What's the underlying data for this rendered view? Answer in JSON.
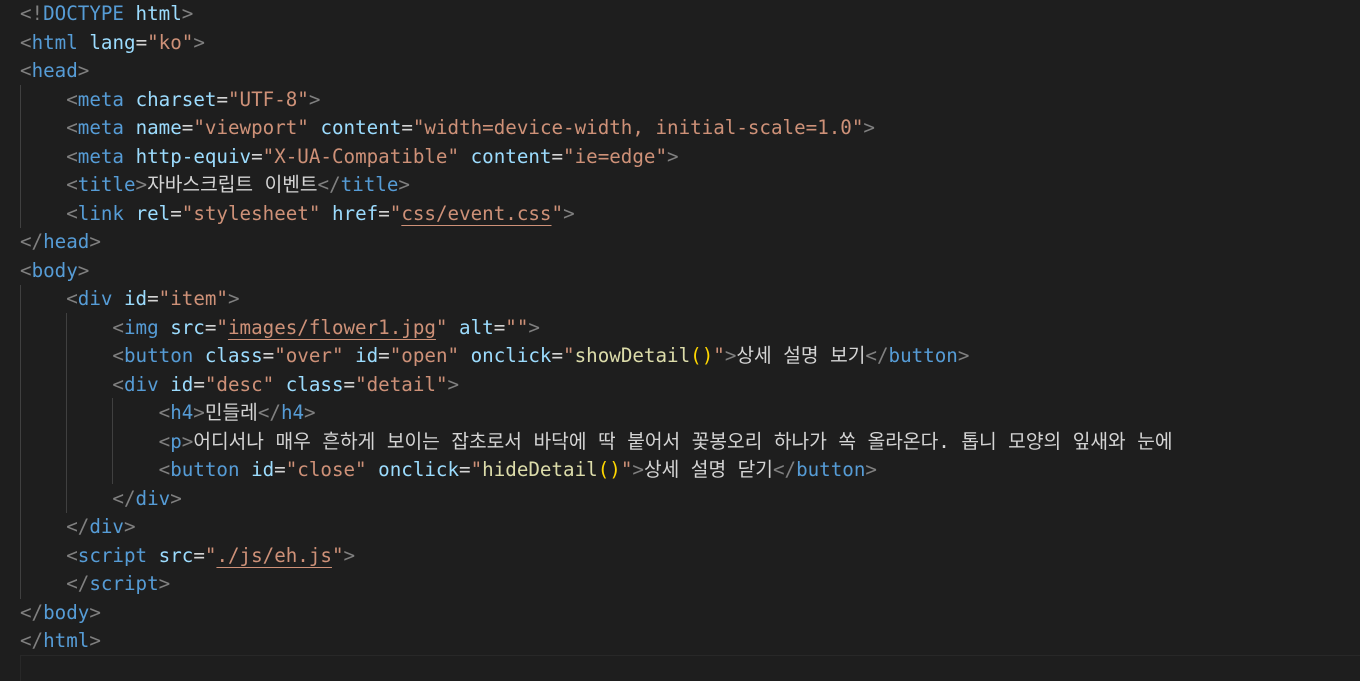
{
  "editor": {
    "background": "#1e1e1e",
    "colors": {
      "punctuation": "#808080",
      "tag": "#569cd6",
      "attribute": "#9cdcfe",
      "string": "#ce9178",
      "function": "#dcdcaa",
      "parenthesis": "#ffd700",
      "text": "#d4d4d4"
    },
    "lines": [
      [
        [
          "punc",
          "<!"
        ],
        [
          "tag",
          "DOCTYPE"
        ],
        [
          "text",
          " "
        ],
        [
          "attr",
          "html"
        ],
        [
          "punc",
          ">"
        ]
      ],
      [
        [
          "punc",
          "<"
        ],
        [
          "tag",
          "html"
        ],
        [
          "text",
          " "
        ],
        [
          "attr",
          "lang"
        ],
        [
          "text",
          "="
        ],
        [
          "str",
          "\"ko\""
        ],
        [
          "punc",
          ">"
        ]
      ],
      [
        [
          "punc",
          "<"
        ],
        [
          "tag",
          "head"
        ],
        [
          "punc",
          ">"
        ]
      ],
      [
        [
          "text",
          "    "
        ],
        [
          "punc",
          "<"
        ],
        [
          "tag",
          "meta"
        ],
        [
          "text",
          " "
        ],
        [
          "attr",
          "charset"
        ],
        [
          "text",
          "="
        ],
        [
          "str",
          "\"UTF-8\""
        ],
        [
          "punc",
          ">"
        ]
      ],
      [
        [
          "text",
          "    "
        ],
        [
          "punc",
          "<"
        ],
        [
          "tag",
          "meta"
        ],
        [
          "text",
          " "
        ],
        [
          "attr",
          "name"
        ],
        [
          "text",
          "="
        ],
        [
          "str",
          "\"viewport\""
        ],
        [
          "text",
          " "
        ],
        [
          "attr",
          "content"
        ],
        [
          "text",
          "="
        ],
        [
          "str",
          "\"width=device-width, initial-scale=1.0\""
        ],
        [
          "punc",
          ">"
        ]
      ],
      [
        [
          "text",
          "    "
        ],
        [
          "punc",
          "<"
        ],
        [
          "tag",
          "meta"
        ],
        [
          "text",
          " "
        ],
        [
          "attr",
          "http-equiv"
        ],
        [
          "text",
          "="
        ],
        [
          "str",
          "\"X-UA-Compatible\""
        ],
        [
          "text",
          " "
        ],
        [
          "attr",
          "content"
        ],
        [
          "text",
          "="
        ],
        [
          "str",
          "\"ie=edge\""
        ],
        [
          "punc",
          ">"
        ]
      ],
      [
        [
          "text",
          "    "
        ],
        [
          "punc",
          "<"
        ],
        [
          "tag",
          "title"
        ],
        [
          "punc",
          ">"
        ],
        [
          "text",
          "자바스크립트 이벤트"
        ],
        [
          "punc",
          "</"
        ],
        [
          "tag",
          "title"
        ],
        [
          "punc",
          ">"
        ]
      ],
      [
        [
          "text",
          "    "
        ],
        [
          "punc",
          "<"
        ],
        [
          "tag",
          "link"
        ],
        [
          "text",
          " "
        ],
        [
          "attr",
          "rel"
        ],
        [
          "text",
          "="
        ],
        [
          "str",
          "\"stylesheet\""
        ],
        [
          "text",
          " "
        ],
        [
          "attr",
          "href"
        ],
        [
          "text",
          "="
        ],
        [
          "str",
          "\""
        ],
        [
          "link",
          "css/event.css"
        ],
        [
          "str",
          "\""
        ],
        [
          "punc",
          ">"
        ]
      ],
      [
        [
          "punc",
          "</"
        ],
        [
          "tag",
          "head"
        ],
        [
          "punc",
          ">"
        ]
      ],
      [
        [
          "punc",
          "<"
        ],
        [
          "tag",
          "body"
        ],
        [
          "punc",
          ">"
        ]
      ],
      [
        [
          "text",
          "    "
        ],
        [
          "punc",
          "<"
        ],
        [
          "tag",
          "div"
        ],
        [
          "text",
          " "
        ],
        [
          "attr",
          "id"
        ],
        [
          "text",
          "="
        ],
        [
          "str",
          "\"item\""
        ],
        [
          "punc",
          ">"
        ]
      ],
      [
        [
          "text",
          "        "
        ],
        [
          "punc",
          "<"
        ],
        [
          "tag",
          "img"
        ],
        [
          "text",
          " "
        ],
        [
          "attr",
          "src"
        ],
        [
          "text",
          "="
        ],
        [
          "str",
          "\""
        ],
        [
          "link",
          "images/flower1.jpg"
        ],
        [
          "str",
          "\""
        ],
        [
          "text",
          " "
        ],
        [
          "attr",
          "alt"
        ],
        [
          "text",
          "="
        ],
        [
          "str",
          "\"\""
        ],
        [
          "punc",
          ">"
        ]
      ],
      [
        [
          "text",
          "        "
        ],
        [
          "punc",
          "<"
        ],
        [
          "tag",
          "button"
        ],
        [
          "text",
          " "
        ],
        [
          "attr",
          "class"
        ],
        [
          "text",
          "="
        ],
        [
          "str",
          "\"over\""
        ],
        [
          "text",
          " "
        ],
        [
          "attr",
          "id"
        ],
        [
          "text",
          "="
        ],
        [
          "str",
          "\"open\""
        ],
        [
          "text",
          " "
        ],
        [
          "attr",
          "onclick"
        ],
        [
          "text",
          "="
        ],
        [
          "str",
          "\""
        ],
        [
          "func",
          "showDetail"
        ],
        [
          "paren",
          "()"
        ],
        [
          "str",
          "\""
        ],
        [
          "punc",
          ">"
        ],
        [
          "text",
          "상세 설명 보기"
        ],
        [
          "punc",
          "</"
        ],
        [
          "tag",
          "button"
        ],
        [
          "punc",
          ">"
        ]
      ],
      [
        [
          "text",
          "        "
        ],
        [
          "punc",
          "<"
        ],
        [
          "tag",
          "div"
        ],
        [
          "text",
          " "
        ],
        [
          "attr",
          "id"
        ],
        [
          "text",
          "="
        ],
        [
          "str",
          "\"desc\""
        ],
        [
          "text",
          " "
        ],
        [
          "attr",
          "class"
        ],
        [
          "text",
          "="
        ],
        [
          "str",
          "\"detail\""
        ],
        [
          "punc",
          ">"
        ]
      ],
      [
        [
          "text",
          "            "
        ],
        [
          "punc",
          "<"
        ],
        [
          "tag",
          "h4"
        ],
        [
          "punc",
          ">"
        ],
        [
          "text",
          "민들레"
        ],
        [
          "punc",
          "</"
        ],
        [
          "tag",
          "h4"
        ],
        [
          "punc",
          ">"
        ]
      ],
      [
        [
          "text",
          "            "
        ],
        [
          "punc",
          "<"
        ],
        [
          "tag",
          "p"
        ],
        [
          "punc",
          ">"
        ],
        [
          "text",
          "어디서나 매우 흔하게 보이는 잡초로서 바닥에 딱 붙어서 꽃봉오리 하나가 쏙 올라온다. 톱니 모양의 잎새와 눈에"
        ]
      ],
      [
        [
          "text",
          "            "
        ],
        [
          "punc",
          "<"
        ],
        [
          "tag",
          "button"
        ],
        [
          "text",
          " "
        ],
        [
          "attr",
          "id"
        ],
        [
          "text",
          "="
        ],
        [
          "str",
          "\"close\""
        ],
        [
          "text",
          " "
        ],
        [
          "attr",
          "onclick"
        ],
        [
          "text",
          "="
        ],
        [
          "str",
          "\""
        ],
        [
          "func",
          "hideDetail"
        ],
        [
          "paren",
          "()"
        ],
        [
          "str",
          "\""
        ],
        [
          "punc",
          ">"
        ],
        [
          "text",
          "상세 설명 닫기"
        ],
        [
          "punc",
          "</"
        ],
        [
          "tag",
          "button"
        ],
        [
          "punc",
          ">"
        ]
      ],
      [
        [
          "text",
          "        "
        ],
        [
          "punc",
          "</"
        ],
        [
          "tag",
          "div"
        ],
        [
          "punc",
          ">"
        ]
      ],
      [
        [
          "text",
          "    "
        ],
        [
          "punc",
          "</"
        ],
        [
          "tag",
          "div"
        ],
        [
          "punc",
          ">"
        ]
      ],
      [
        [
          "text",
          "    "
        ],
        [
          "punc",
          "<"
        ],
        [
          "tag",
          "script"
        ],
        [
          "text",
          " "
        ],
        [
          "attr",
          "src"
        ],
        [
          "text",
          "="
        ],
        [
          "str",
          "\""
        ],
        [
          "link",
          "./js/eh.js"
        ],
        [
          "str",
          "\""
        ],
        [
          "punc",
          ">"
        ]
      ],
      [
        [
          "text",
          "    "
        ],
        [
          "punc",
          "</"
        ],
        [
          "tag",
          "script"
        ],
        [
          "punc",
          ">"
        ]
      ],
      [
        [
          "punc",
          "</"
        ],
        [
          "tag",
          "body"
        ],
        [
          "punc",
          ">"
        ]
      ],
      [
        [
          "punc",
          "</"
        ],
        [
          "tag",
          "html"
        ],
        [
          "punc",
          ">"
        ]
      ]
    ]
  }
}
